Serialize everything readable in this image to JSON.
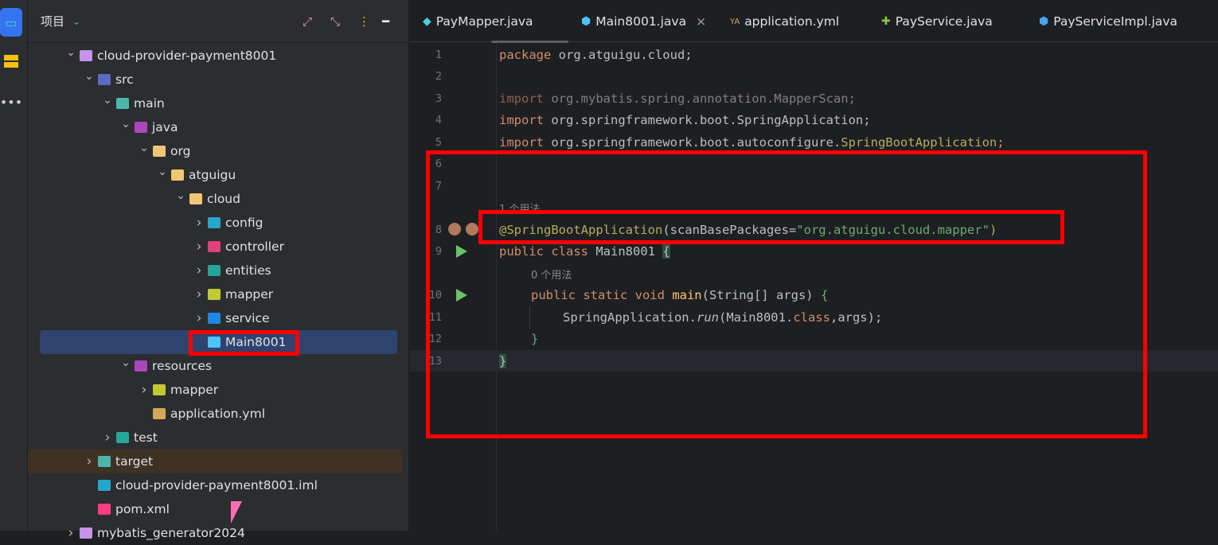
{
  "project_panel": {
    "title": "项目",
    "tree": [
      {
        "label": "cloud-provider-payment8001",
        "depth": 0,
        "chevron": "down",
        "icon": "module-folder-icon",
        "color": "#c792ea"
      },
      {
        "label": "src",
        "depth": 1,
        "chevron": "down",
        "icon": "source-folder-icon",
        "color": "#5c6bc0"
      },
      {
        "label": "main",
        "depth": 2,
        "chevron": "down",
        "icon": "folder-icon",
        "color": "#4db6ac"
      },
      {
        "label": "java",
        "depth": 3,
        "chevron": "down",
        "icon": "java-folder-icon",
        "color": "#ab47bc"
      },
      {
        "label": "org",
        "depth": 4,
        "chevron": "down",
        "icon": "package-folder-icon",
        "color": "#f0c674"
      },
      {
        "label": "atguigu",
        "depth": 5,
        "chevron": "down",
        "icon": "package-folder-icon",
        "color": "#f0c674"
      },
      {
        "label": "cloud",
        "depth": 6,
        "chevron": "down",
        "icon": "package-folder-icon",
        "color": "#f0c674"
      },
      {
        "label": "config",
        "depth": 7,
        "chevron": "right",
        "icon": "config-folder-icon",
        "color": "#26a6c9"
      },
      {
        "label": "controller",
        "depth": 7,
        "chevron": "right",
        "icon": "controller-folder-icon",
        "color": "#e0407a"
      },
      {
        "label": "entities",
        "depth": 7,
        "chevron": "right",
        "icon": "entities-folder-icon",
        "color": "#26a69a"
      },
      {
        "label": "mapper",
        "depth": 7,
        "chevron": "right",
        "icon": "mapper-folder-icon",
        "color": "#c0ca33"
      },
      {
        "label": "service",
        "depth": 7,
        "chevron": "right",
        "icon": "service-folder-icon",
        "color": "#1e88e5"
      },
      {
        "label": "Main8001",
        "depth": 7,
        "chevron": "",
        "icon": "spring-class-icon",
        "color": "#4fc3f7",
        "selected": true
      },
      {
        "label": "resources",
        "depth": 3,
        "chevron": "down",
        "icon": "resources-folder-icon",
        "color": "#ab47bc"
      },
      {
        "label": "mapper",
        "depth": 4,
        "chevron": "right",
        "icon": "mapper-folder-icon",
        "color": "#c0ca33"
      },
      {
        "label": "application.yml",
        "depth": 4,
        "chevron": "",
        "icon": "yaml-file-icon",
        "color": "#d4a85a"
      },
      {
        "label": "test",
        "depth": 2,
        "chevron": "right",
        "icon": "test-folder-icon",
        "color": "#26a69a"
      },
      {
        "label": "target",
        "depth": 1,
        "chevron": "right",
        "icon": "target-folder-icon",
        "color": "#4db6ac",
        "excluded": true
      },
      {
        "label": "cloud-provider-payment8001.iml",
        "depth": 1,
        "chevron": "",
        "icon": "iml-file-icon",
        "color": "#26a6c9"
      },
      {
        "label": "pom.xml",
        "depth": 1,
        "chevron": "",
        "icon": "maven-file-icon",
        "color": "#ff3d7f"
      },
      {
        "label": "mybatis_generator2024",
        "depth": 0,
        "chevron": "right",
        "icon": "module-folder-icon",
        "color": "#c792ea"
      }
    ]
  },
  "tabs": [
    {
      "label": "PayMapper.java",
      "icon": "mapper-icon",
      "color": "#4dd0e1"
    },
    {
      "label": "Main8001.java",
      "icon": "spring-class-icon",
      "color": "#4fc3f7",
      "active": true,
      "close": "×"
    },
    {
      "label": "application.yml",
      "icon": "yaml-icon",
      "color": "#d4a85a"
    },
    {
      "label": "PayService.java",
      "icon": "interface-icon",
      "color": "#8bc34a"
    },
    {
      "label": "PayServiceImpl.java",
      "icon": "class-icon",
      "color": "#42a5f5"
    }
  ],
  "code": {
    "line_numbers": [
      "1",
      "2",
      "3",
      "4",
      "5",
      "6",
      "7",
      "8",
      "9",
      "10",
      "11",
      "12",
      "13"
    ],
    "l1": [
      "package ",
      "org.atguigu.cloud;"
    ],
    "l3": [
      "import ",
      "org.mybatis.spring.annotation.MapperScan;"
    ],
    "l4": [
      "import ",
      "org.springframework.boot.SpringApplication;"
    ],
    "l5": [
      "import ",
      "org.springframework.boot.autoconfigure.",
      "SpringBootApplication",
      ";"
    ],
    "hint8": "1 个用法",
    "l8": [
      "@SpringBootApplication",
      "(scanBasePackages=",
      "\"org.atguigu.cloud.mapper\"",
      ")"
    ],
    "l9": [
      "public class ",
      "Main8001 ",
      "{"
    ],
    "hint10": "0 个用法",
    "l10": [
      "public static void ",
      "main",
      "(String[] args) ",
      "{"
    ],
    "l11": [
      "SpringApplication.",
      "run",
      "(Main8001.",
      "class",
      ",args);"
    ],
    "l12": "}",
    "l13": "}"
  },
  "highlight_color": "#ff0000"
}
